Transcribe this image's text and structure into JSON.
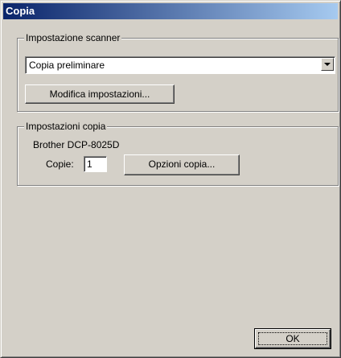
{
  "window": {
    "title": "Copia"
  },
  "scanner_group": {
    "label": "Impostazione scanner",
    "combo_value": "Copia preliminare",
    "modify_button": "Modifica impostazioni..."
  },
  "copy_group": {
    "label": "Impostazioni copia",
    "device_name": "Brother DCP-8025D",
    "copies_label": "Copie:",
    "copies_value": "1",
    "options_button": "Opzioni copia..."
  },
  "ok_button": "OK"
}
